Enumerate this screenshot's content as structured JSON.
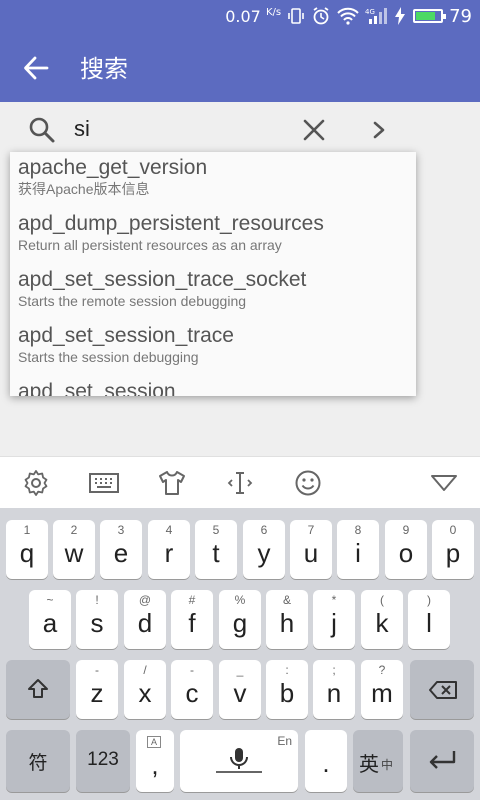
{
  "status_bar": {
    "speed_value": "0.07",
    "speed_unit": "K/s",
    "network": "4G",
    "battery": "79",
    "battery_level_pct": 79
  },
  "app_bar": {
    "title": "搜索",
    "back_icon": "arrow-left-icon"
  },
  "search": {
    "value": "si",
    "search_icon": "search-icon",
    "clear_icon": "close-icon",
    "go_icon": "chevron-right-icon"
  },
  "suggestions": [
    {
      "name": "apache_get_version",
      "desc": "获得Apache版本信息"
    },
    {
      "name": "apd_dump_persistent_resources",
      "desc": "Return all persistent resources as an array"
    },
    {
      "name": "apd_set_session_trace_socket",
      "desc": "Starts the remote session debugging"
    },
    {
      "name": "apd_set_session_trace",
      "desc": "Starts the session debugging"
    },
    {
      "name": "apd_set_session",
      "desc": ""
    }
  ],
  "keyboard": {
    "toolbar": [
      "gear-icon",
      "keyboard-icon",
      "tshirt-icon",
      "text-cursor-icon",
      "smiley-icon",
      "collapse-triangle-icon"
    ],
    "row1": [
      {
        "hint": "1",
        "key": "q"
      },
      {
        "hint": "2",
        "key": "w"
      },
      {
        "hint": "3",
        "key": "e"
      },
      {
        "hint": "4",
        "key": "r"
      },
      {
        "hint": "5",
        "key": "t"
      },
      {
        "hint": "6",
        "key": "y"
      },
      {
        "hint": "7",
        "key": "u"
      },
      {
        "hint": "8",
        "key": "i"
      },
      {
        "hint": "9",
        "key": "o"
      },
      {
        "hint": "0",
        "key": "p"
      }
    ],
    "row2": [
      {
        "hint": "~",
        "key": "a"
      },
      {
        "hint": "!",
        "key": "s"
      },
      {
        "hint": "@",
        "key": "d"
      },
      {
        "hint": "#",
        "key": "f"
      },
      {
        "hint": "%",
        "key": "g"
      },
      {
        "hint": "&",
        "key": "h"
      },
      {
        "hint": "*",
        "key": "j"
      },
      {
        "hint": "(",
        "key": "k"
      },
      {
        "hint": ")",
        "key": "l"
      }
    ],
    "row3": [
      {
        "hint": "-",
        "key": "z"
      },
      {
        "hint": "/",
        "key": "x"
      },
      {
        "hint": "-",
        "key": "c"
      },
      {
        "hint": "_",
        "key": "v"
      },
      {
        "hint": ":",
        "key": "b"
      },
      {
        "hint": ";",
        "key": "n"
      },
      {
        "hint": "?",
        "key": "m"
      }
    ],
    "shift_icon": "shift-arrow-icon",
    "backspace_icon": "backspace-icon",
    "row4": {
      "symbols": "符",
      "numbers": "123",
      "comma": ",",
      "comma_hint": "A",
      "space_hint": "En",
      "mic_icon": "microphone-icon",
      "period": ".",
      "lang_main": "英",
      "lang_sub": "中",
      "enter_icon": "enter-arrow-icon"
    }
  }
}
